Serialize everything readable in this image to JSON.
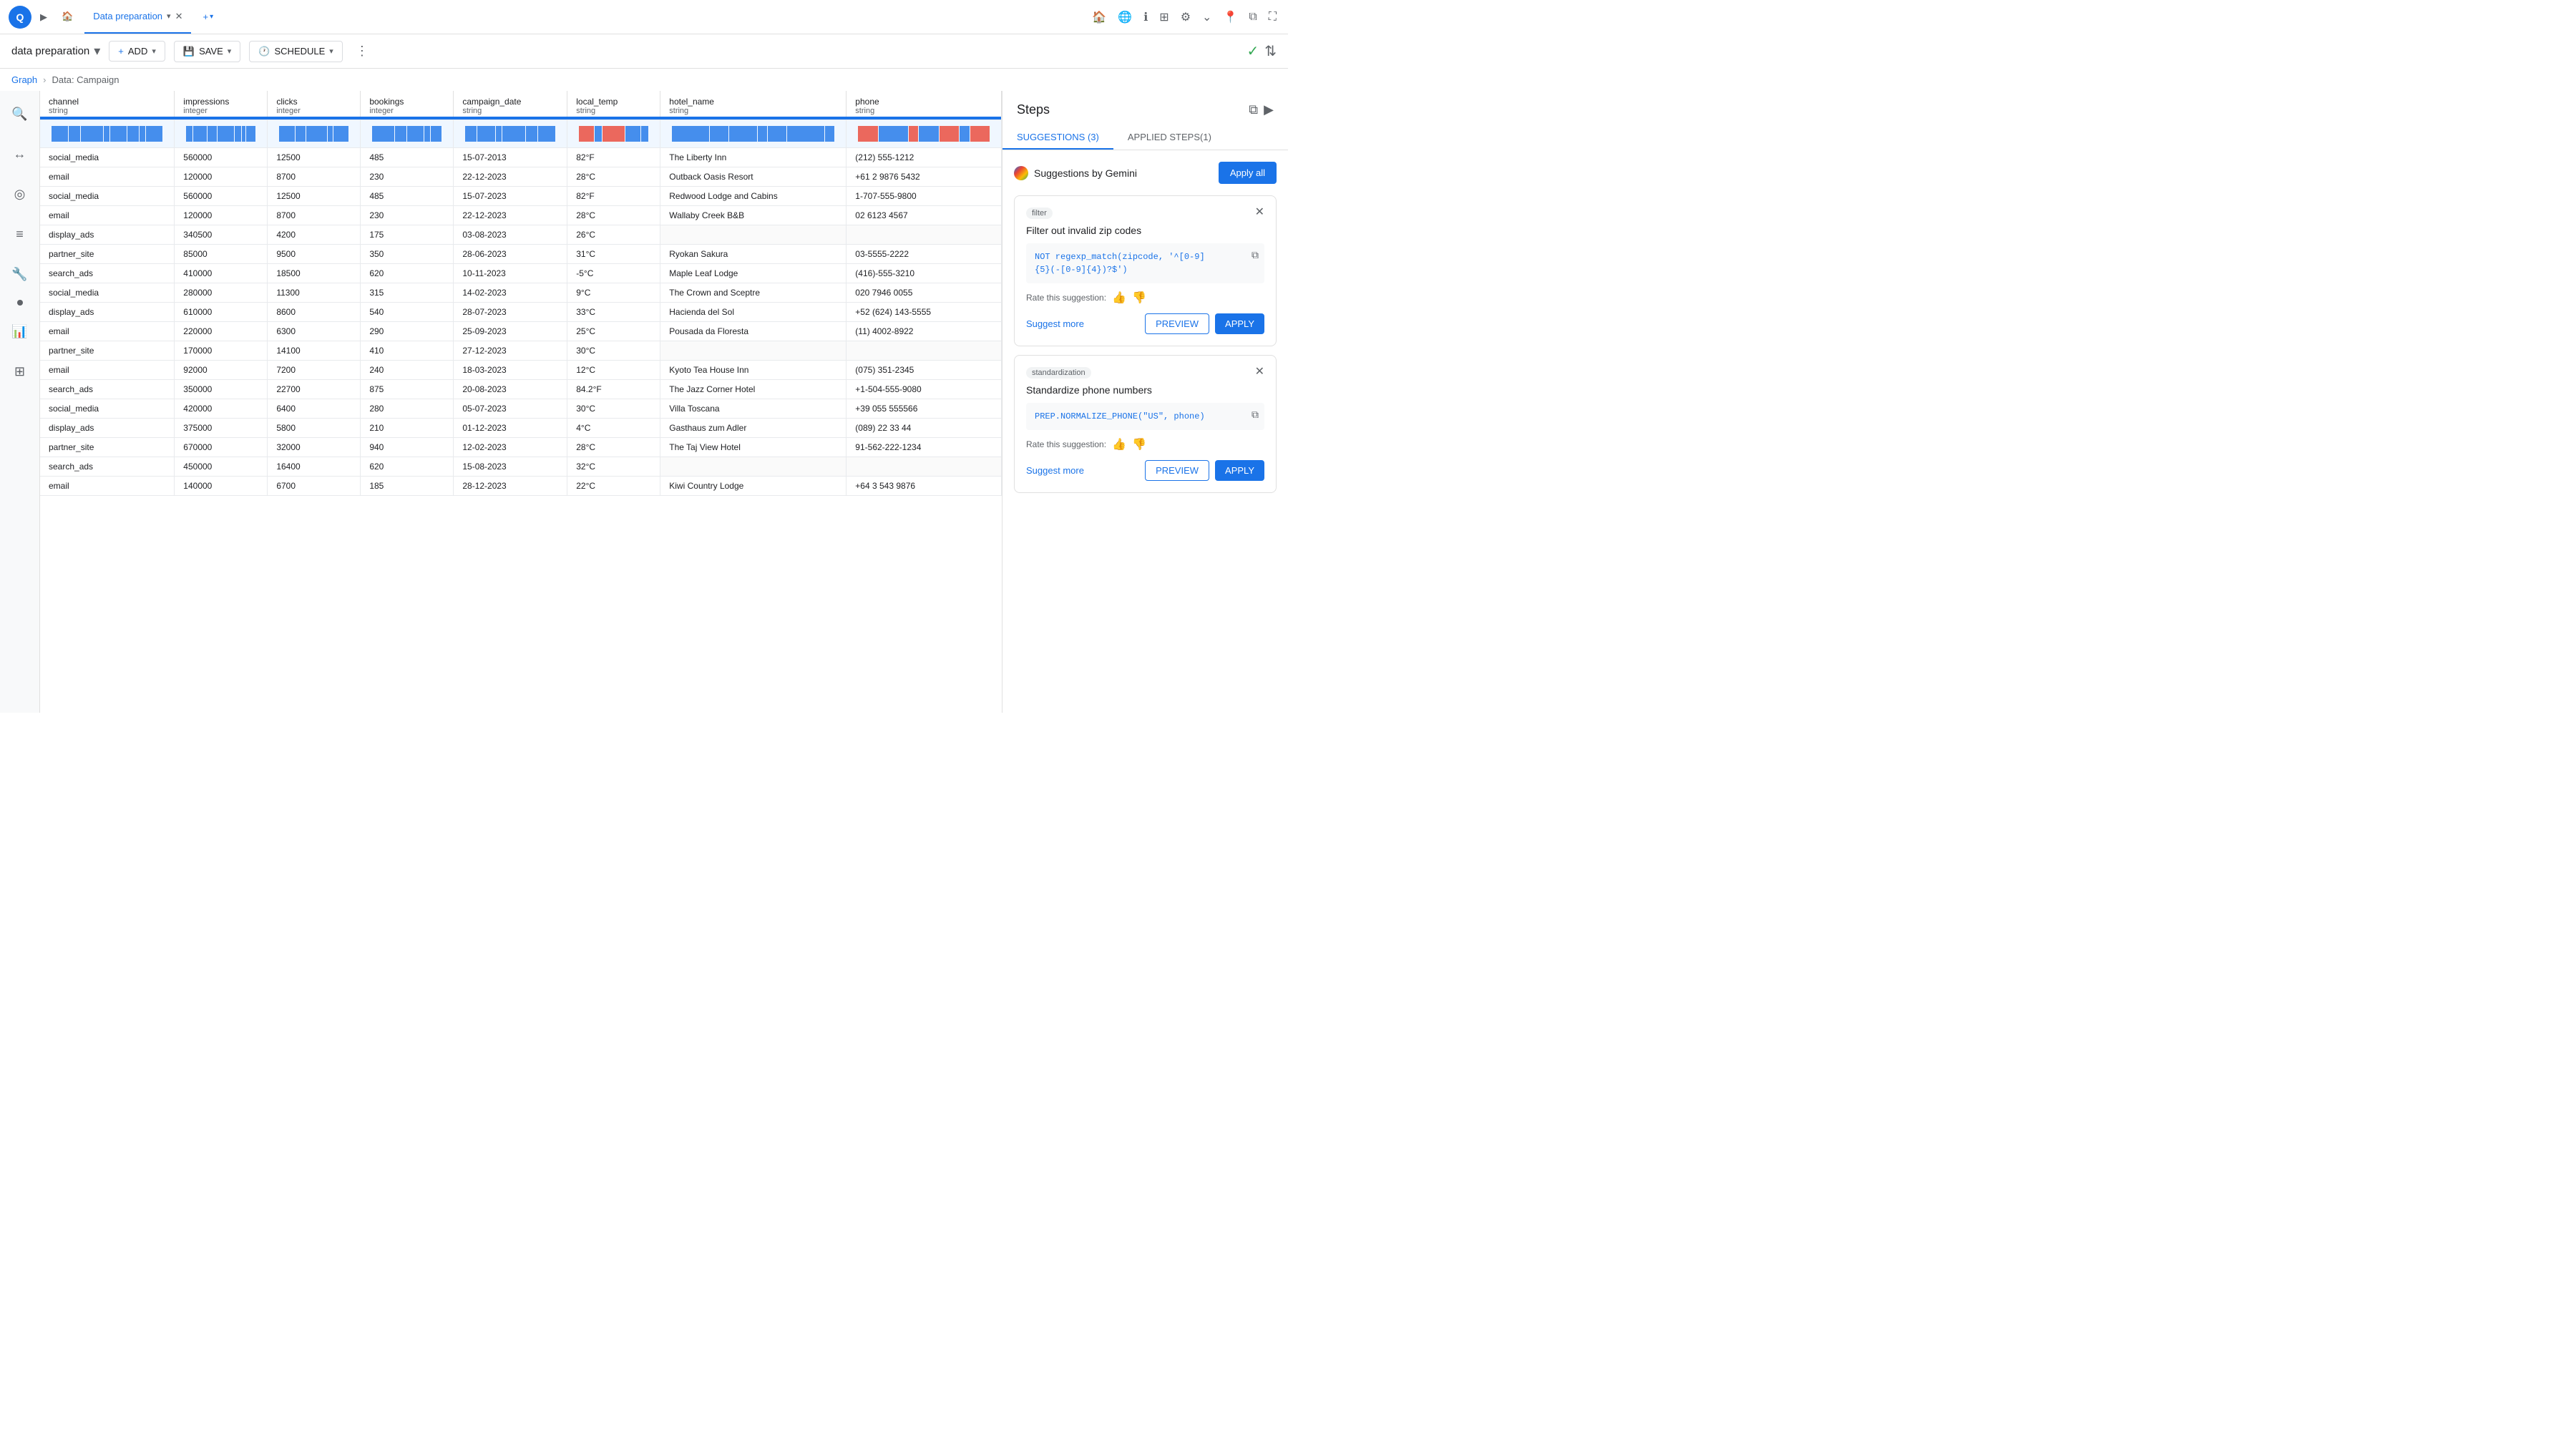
{
  "topBar": {
    "logo": "Q",
    "tabs": [
      {
        "id": "home",
        "label": "🏠",
        "active": false
      },
      {
        "id": "prep",
        "label": "Data preparation",
        "active": true
      }
    ],
    "addTab": "+▾",
    "rightIcons": [
      "home",
      "globe",
      "info",
      "grid",
      "settings",
      "dropdown",
      "pin",
      "window",
      "expand"
    ]
  },
  "secondBar": {
    "title": "data preparation",
    "dropdownArrow": "▾",
    "buttons": [
      {
        "id": "add",
        "label": "ADD",
        "icon": "+"
      },
      {
        "id": "save",
        "label": "SAVE",
        "icon": "💾"
      },
      {
        "id": "schedule",
        "label": "SCHEDULE",
        "icon": "🕐"
      }
    ],
    "moreIcon": "⋮",
    "rightIcons": [
      "check",
      "chevrons"
    ]
  },
  "breadcrumb": {
    "items": [
      "Graph",
      "Data: Campaign"
    ]
  },
  "table": {
    "columns": [
      {
        "id": "channel",
        "name": "channel",
        "type": "string"
      },
      {
        "id": "impressions",
        "name": "impressions",
        "type": "integer"
      },
      {
        "id": "clicks",
        "name": "clicks",
        "type": "integer"
      },
      {
        "id": "bookings",
        "name": "bookings",
        "type": "integer"
      },
      {
        "id": "campaign_date",
        "name": "campaign_date",
        "type": "string"
      },
      {
        "id": "local_temp",
        "name": "local_temp",
        "type": "string"
      },
      {
        "id": "hotel_name",
        "name": "hotel_name",
        "type": "string"
      },
      {
        "id": "phone",
        "name": "phone",
        "type": "string"
      }
    ],
    "rows": [
      [
        "social_media",
        "560000",
        "12500",
        "485",
        "15-07-2013",
        "82°F",
        "The Liberty Inn",
        "(212) 555-1212"
      ],
      [
        "email",
        "120000",
        "8700",
        "230",
        "22-12-2023",
        "28°C",
        "Outback Oasis Resort",
        "+61 2 9876 5432"
      ],
      [
        "social_media",
        "560000",
        "12500",
        "485",
        "15-07-2023",
        "82°F",
        "Redwood Lodge and Cabins",
        "1-707-555-9800"
      ],
      [
        "email",
        "120000",
        "8700",
        "230",
        "22-12-2023",
        "28°C",
        "Wallaby Creek B&B",
        "02 6123 4567"
      ],
      [
        "display_ads",
        "340500",
        "4200",
        "175",
        "03-08-2023",
        "26°C",
        "",
        ""
      ],
      [
        "partner_site",
        "85000",
        "9500",
        "350",
        "28-06-2023",
        "31°C",
        "Ryokan Sakura",
        "03-5555-2222"
      ],
      [
        "search_ads",
        "410000",
        "18500",
        "620",
        "10-11-2023",
        "-5°C",
        "Maple Leaf Lodge",
        "(416)-555-3210"
      ],
      [
        "social_media",
        "280000",
        "11300",
        "315",
        "14-02-2023",
        "9°C",
        "The Crown and Sceptre",
        "020 7946 0055"
      ],
      [
        "display_ads",
        "610000",
        "8600",
        "540",
        "28-07-2023",
        "33°C",
        "Hacienda del Sol",
        "+52 (624) 143-5555"
      ],
      [
        "email",
        "220000",
        "6300",
        "290",
        "25-09-2023",
        "25°C",
        "Pousada da Floresta",
        "(11) 4002-8922"
      ],
      [
        "partner_site",
        "170000",
        "14100",
        "410",
        "27-12-2023",
        "30°C",
        "",
        ""
      ],
      [
        "email",
        "92000",
        "7200",
        "240",
        "18-03-2023",
        "12°C",
        "Kyoto Tea House Inn",
        "(075) 351-2345"
      ],
      [
        "search_ads",
        "350000",
        "22700",
        "875",
        "20-08-2023",
        "84.2°F",
        "The Jazz Corner Hotel",
        "+1-504-555-9080"
      ],
      [
        "social_media",
        "420000",
        "6400",
        "280",
        "05-07-2023",
        "30°C",
        "Villa Toscana",
        "+39 055 555566"
      ],
      [
        "display_ads",
        "375000",
        "5800",
        "210",
        "01-12-2023",
        "4°C",
        "Gasthaus zum Adler",
        "(089) 22 33 44"
      ],
      [
        "partner_site",
        "670000",
        "32000",
        "940",
        "12-02-2023",
        "28°C",
        "The Taj View Hotel",
        "91-562-222-1234"
      ],
      [
        "search_ads",
        "450000",
        "16400",
        "620",
        "15-08-2023",
        "32°C",
        "",
        ""
      ],
      [
        "email",
        "140000",
        "6700",
        "185",
        "28-12-2023",
        "22°C",
        "Kiwi Country Lodge",
        "+64 3 543 9876"
      ]
    ]
  },
  "steps": {
    "title": "Steps",
    "tabs": [
      {
        "id": "suggestions",
        "label": "SUGGESTIONS (3)",
        "active": true
      },
      {
        "id": "applied",
        "label": "APPLIED STEPS(1)",
        "active": false
      }
    ],
    "geminiLabel": "Suggestions by Gemini",
    "applyAllLabel": "Apply all",
    "suggestions": [
      {
        "id": "filter",
        "tag": "filter",
        "title": "Filter out invalid zip codes",
        "code": "NOT regexp_match(zipcode, '^[0-9]{5}(-[0-9]{4})?$')",
        "ratingLabel": "Rate this suggestion:",
        "suggestMore": "Suggest more",
        "preview": "PREVIEW",
        "apply": "APPLY"
      },
      {
        "id": "standardization",
        "tag": "standardization",
        "title": "Standardize phone numbers",
        "code": "PREP.NORMALIZE_PHONE(\"US\", phone)",
        "ratingLabel": "Rate this suggestion:",
        "suggestMore": "Suggest more",
        "preview": "PREVIEW",
        "apply": "APPLY"
      }
    ]
  },
  "leftSidebar": {
    "icons": [
      "search",
      "layers",
      "circle",
      "list",
      "wrench",
      "dot",
      "bar-chart",
      "table"
    ]
  }
}
